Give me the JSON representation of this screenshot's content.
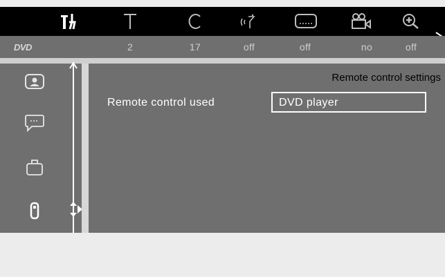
{
  "topbar": {
    "icons": [
      "tools-icon",
      "text-icon",
      "clock-icon",
      "audio-icon",
      "subtitle-icon",
      "camera-icon",
      "zoom-icon"
    ]
  },
  "valuebar": {
    "logo_text": "DVD",
    "values": [
      "2",
      "17",
      "off",
      "off",
      "no",
      "off"
    ]
  },
  "leftmenu": {
    "items": [
      "person-icon",
      "speech-bubble-icon",
      "briefcase-icon",
      "remote-control-icon"
    ]
  },
  "panel": {
    "title": "Remote control settings",
    "setting_label": "Remote control used",
    "setting_value": "DVD player"
  },
  "colors": {
    "panel_bg": "#6f6f6f",
    "topbar_bg": "#000000",
    "page_bg": "#ececec"
  }
}
